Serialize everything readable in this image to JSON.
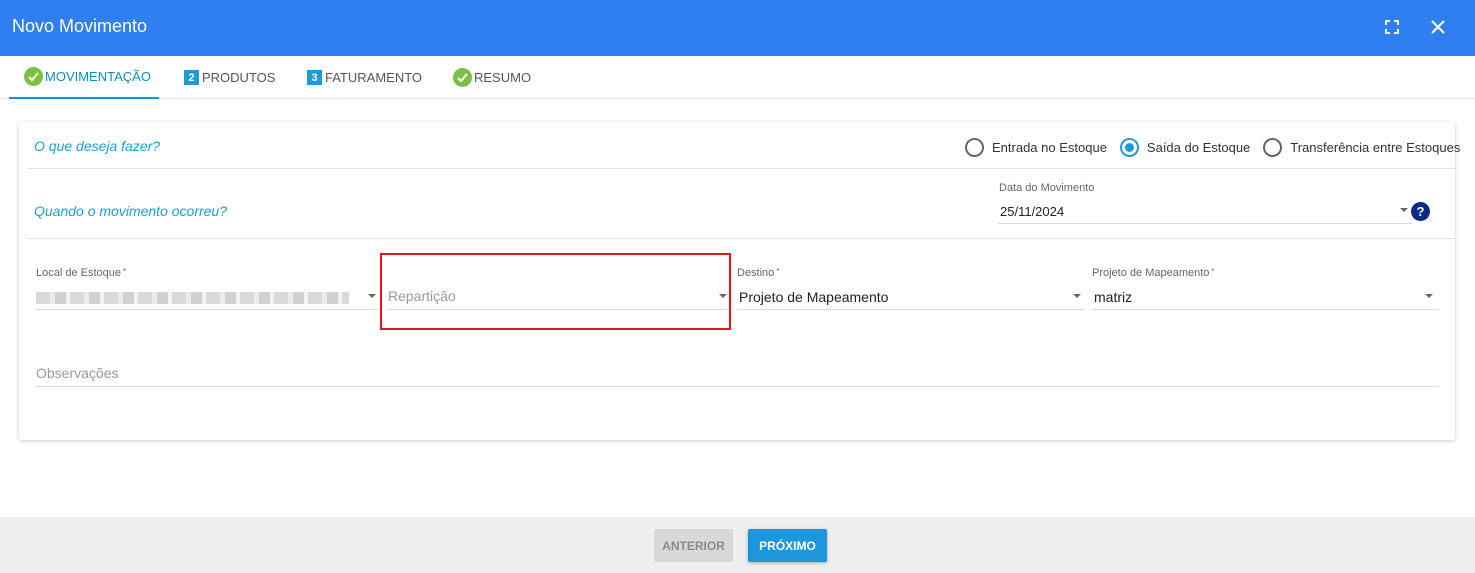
{
  "window": {
    "title": "Novo Movimento",
    "icons": {
      "fullscreen": "fullscreen-icon",
      "close": "close-icon"
    }
  },
  "tabs": [
    {
      "label": "MOVIMENTAÇÃO",
      "marker": "check",
      "active": true
    },
    {
      "label": "PRODUTOS",
      "marker": "2",
      "active": false
    },
    {
      "label": "FATURAMENTO",
      "marker": "3",
      "active": false
    },
    {
      "label": "RESUMO",
      "marker": "check",
      "active": false
    }
  ],
  "section1": {
    "question": "O que deseja fazer?",
    "options": [
      {
        "label": "Entrada no Estoque",
        "selected": false
      },
      {
        "label": "Saída do Estoque",
        "selected": true
      },
      {
        "label": "Transferência entre Estoques",
        "selected": false
      }
    ]
  },
  "section2": {
    "question": "Quando o movimento ocorreu?",
    "date_label": "Data do Movimento",
    "date_value": "25/11/2024",
    "help": "?"
  },
  "fields": {
    "local": {
      "label": "Local de Estoque",
      "required": "*"
    },
    "reparticao": {
      "placeholder": "Repartição"
    },
    "destino": {
      "label": "Destino",
      "required": "*",
      "value": "Projeto de Mapeamento"
    },
    "projeto": {
      "label": "Projeto de Mapeamento",
      "required": "*",
      "value": "matriz"
    },
    "observacoes": {
      "placeholder": "Observações"
    }
  },
  "footer": {
    "prev_label": "ANTERIOR",
    "next_label": "PRÓXIMO"
  },
  "colors": {
    "header": "#2f7ff2",
    "accent": "#1e9bd7",
    "check": "#7ac143",
    "highlight": "#e8141c"
  }
}
